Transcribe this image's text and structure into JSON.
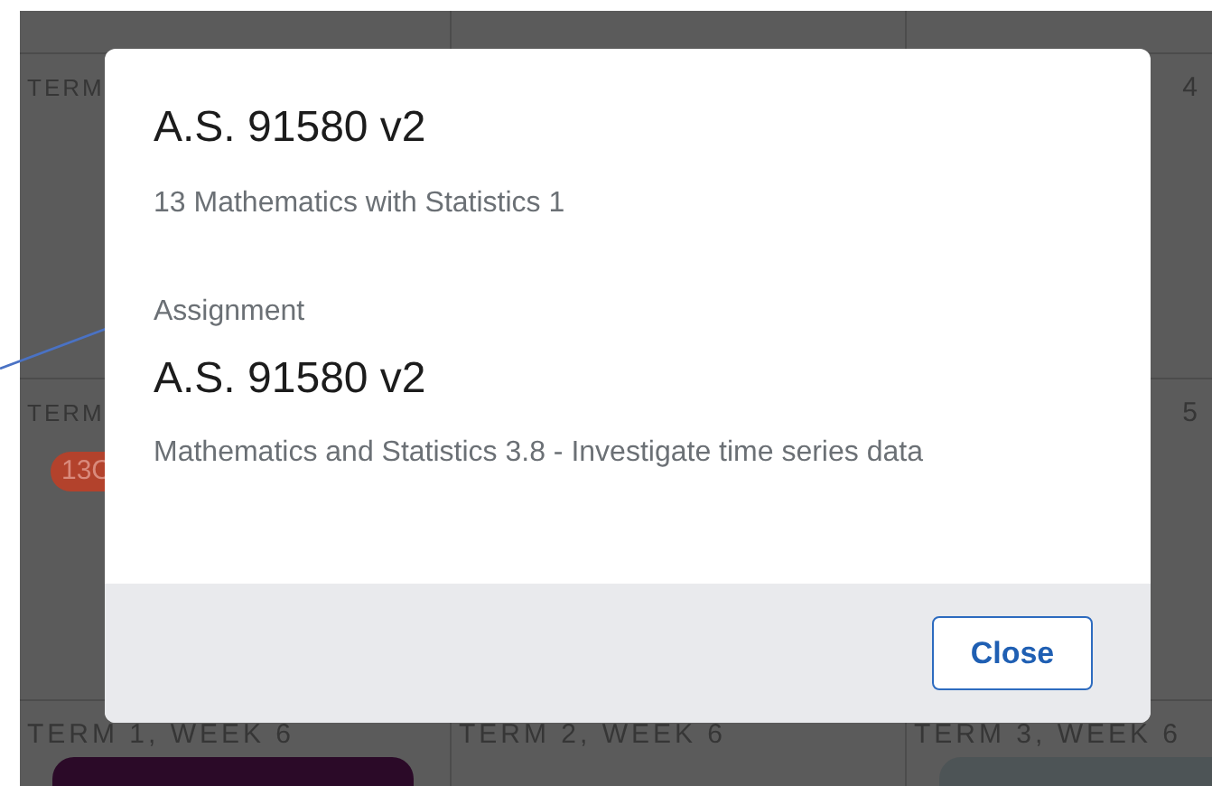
{
  "calendar": {
    "rows": [
      {
        "cells": [
          {
            "kind": "cut",
            "label": "TERM"
          },
          {
            "kind": "empty"
          },
          {
            "kind": "cut_start",
            "label": "4"
          }
        ]
      },
      {
        "cells": [
          {
            "kind": "cut",
            "label": "TERM",
            "tags": [
              {
                "text": "13C",
                "color": "#b3422c"
              }
            ]
          },
          {
            "kind": "empty"
          },
          {
            "kind": "cut_start",
            "label": "5"
          }
        ]
      },
      {
        "cells": [
          {
            "kind": "full",
            "label": "TERM 1, WEEK 6",
            "tags": [
              {
                "color": "#2b0a28"
              }
            ]
          },
          {
            "kind": "full",
            "label": "TERM 2, WEEK 6"
          },
          {
            "kind": "full",
            "label": "TERM 3, WEEK 6",
            "tags": [
              {
                "color": "#4d5456"
              }
            ]
          }
        ]
      }
    ]
  },
  "dialog": {
    "title": "A.S. 91580 v2",
    "subtitle": "13 Mathematics with Statistics 1",
    "section_label": "Assignment",
    "section_title": "A.S. 91580 v2",
    "section_description": "Mathematics and Statistics 3.8 - Investigate time series data",
    "buttons": [
      {
        "label": "Close"
      }
    ]
  }
}
